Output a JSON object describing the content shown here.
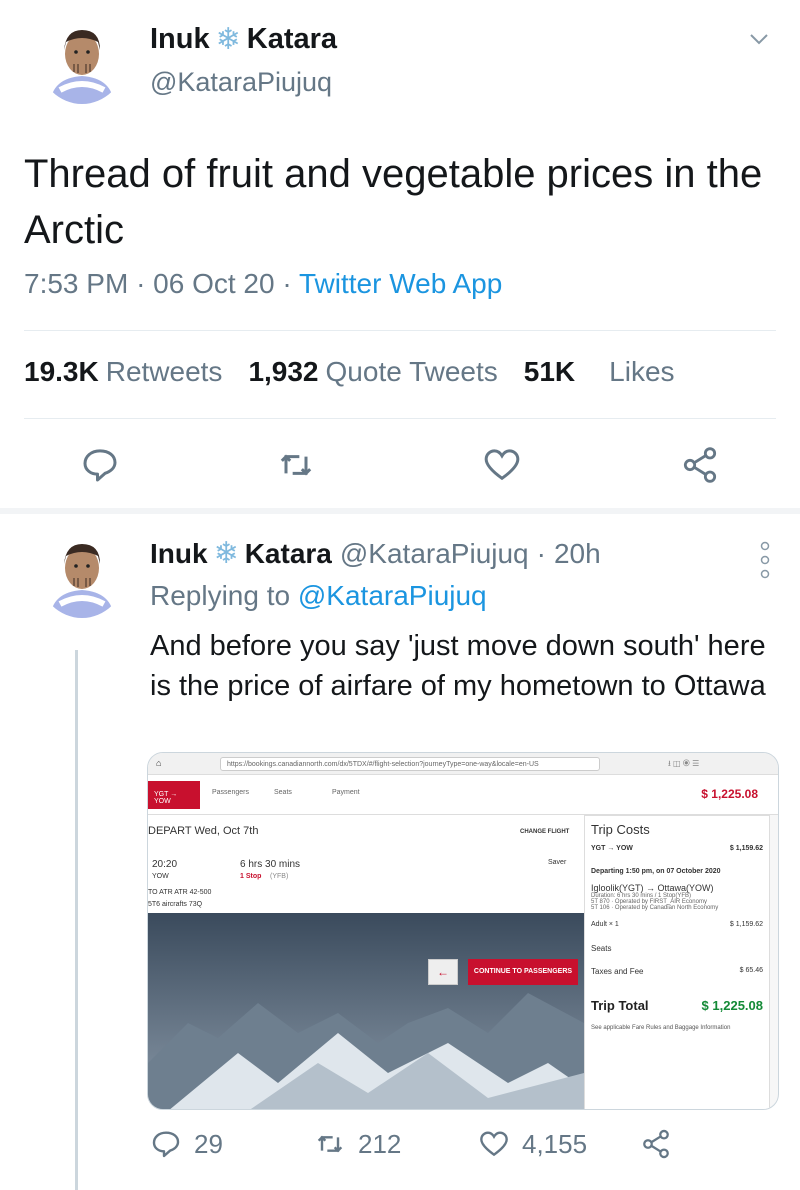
{
  "main_tweet": {
    "display_name_first": "Inuk",
    "display_name_last": "Katara",
    "snowflake": "❄",
    "handle": "@KataraPiujuq",
    "text": "Thread of fruit and vegetable prices in the Arctic",
    "time": "7:53 PM",
    "date": "06 Oct 20",
    "source": "Twitter Web App",
    "sep": "·",
    "stats": {
      "retweets_count": "19.3K",
      "retweets_label": "Retweets",
      "quotes_count": "1,932",
      "quotes_label": "Quote Tweets",
      "likes_count": "51K",
      "likes_label": "Likes"
    }
  },
  "reply_tweet": {
    "display_name_first": "Inuk",
    "display_name_last": "Katara",
    "handle": "@KataraPiujuq",
    "age": "20h",
    "replying_label": "Replying to",
    "replying_mention": "@KataraPiujuq",
    "text": "And before you say 'just move down south' here is the price of airfare of my hometown to Ottawa",
    "counts": {
      "replies": "29",
      "retweets": "212",
      "likes": "4,155"
    }
  },
  "embedded_screenshot": {
    "url": "https://bookings.canadiannorth.com/dx/5TDX/#/flight-selection?journeyType=one-way&locale=en-US",
    "step_flight": "YGT → YOW",
    "step_passengers": "Passengers",
    "step_seats": "Seats",
    "step_payment": "Payment",
    "top_price": "$ 1,225.08",
    "depart_label": "DEPART Wed, Oct 7th",
    "change_flight": "CHANGE FLIGHT",
    "dep_time": "20:20",
    "dep_airport": "YOW",
    "duration": "6 hrs 30 mins",
    "stops": "1 Stop",
    "stops_via": "(YFB)",
    "fare": "Saver",
    "flight_info_1": "TO ATR ATR 42-500",
    "flight_info_2": "5T6 aircrafts 73Q",
    "back_arrow": "←",
    "continue_btn": "CONTINUE TO PASSENGERS",
    "trip_costs_title": "Trip Costs",
    "route": "YGT → YOW",
    "route_price": "$ 1,159.62",
    "departing": "Departing 1:50 pm, on 07 October 2020",
    "from_to": "Igloolik(YGT) → Ottawa(YOW)",
    "duration_detail": "Duration: 6 hrs 30 mins / 1 Stop(YFB)",
    "leg1": "5T 870 · Operated by FIRST_AIR Economy",
    "leg2": "5T 106 · Operated by Canadian North Economy",
    "adult": "Adult × 1",
    "adult_price": "$ 1,159.62",
    "seats_label": "Seats",
    "taxes_label": "Taxes and Fee",
    "taxes_value": "$ 65.46",
    "trip_total_label": "Trip Total",
    "trip_total_value": "$ 1,225.08",
    "fare_rules_note": "See applicable Fare Rules and Baggage Information"
  },
  "colors": {
    "link": "#1b95e0",
    "secondary_text": "#657786",
    "primary_text": "#14171a",
    "divider": "#e6ecf0",
    "airline_red": "#c8102e"
  },
  "icons": {
    "reply": "reply-icon",
    "retweet": "retweet-icon",
    "like": "heart-icon",
    "share": "share-icon",
    "more": "more-vertical-icon",
    "chevron": "chevron-down-icon"
  }
}
